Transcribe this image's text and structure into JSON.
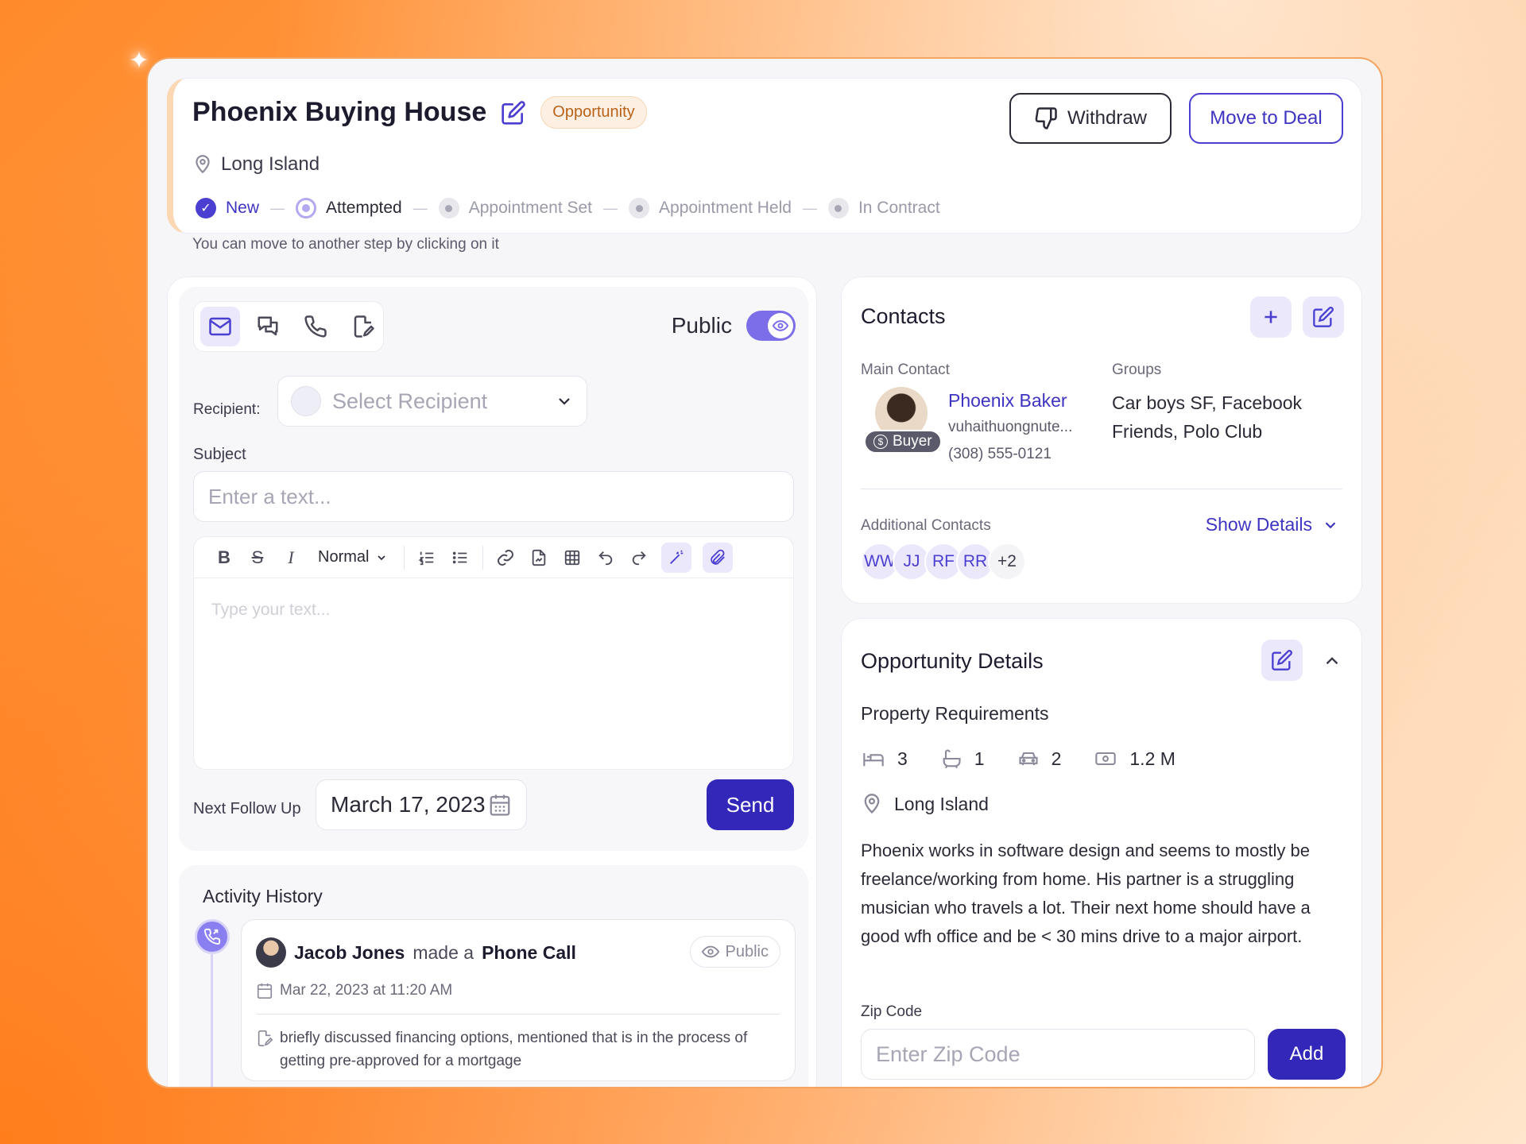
{
  "header": {
    "title": "Phoenix Buying House",
    "badge": "Opportunity",
    "location": "Long Island",
    "withdraw_label": "Withdraw",
    "move_label": "Move to Deal",
    "steps": [
      "New",
      "Attempted",
      "Appointment Set",
      "Appointment Held",
      "In Contract"
    ],
    "step_states": [
      "done",
      "current",
      "pending",
      "pending",
      "pending"
    ],
    "hint": "You can move to another step by clicking on it"
  },
  "composer": {
    "channels": [
      "mail-icon",
      "chat-icon",
      "phone-icon",
      "note-icon"
    ],
    "public_label": "Public",
    "public_on": true,
    "recipient_label": "Recipient:",
    "recipient_placeholder": "Select Recipient",
    "subject_label": "Subject",
    "subject_placeholder": "Enter a text...",
    "format_value": "Normal",
    "editor_placeholder": "Type your text...",
    "follow_label": "Next Follow Up",
    "follow_date": "March 17, 2023",
    "send_label": "Send"
  },
  "activity": {
    "title": "Activity History",
    "item": {
      "name": "Jacob Jones",
      "verb": "made a",
      "type": "Phone Call",
      "visibility": "Public",
      "date": "Mar 22, 2023 at 11:20 AM",
      "note": "briefly discussed financing options, mentioned that is in the process of getting pre-approved for a mortgage"
    }
  },
  "contacts": {
    "title": "Contacts",
    "main_label": "Main Contact",
    "groups_label": "Groups",
    "name": "Phoenix Baker",
    "role": "Buyer",
    "email": "vuhaithuongnute...",
    "phone": "(308) 555-0121",
    "groups": "Car boys SF, Facebook Friends, Polo Club",
    "additional_label": "Additional Contacts",
    "show_details": "Show Details",
    "chips": [
      "WW",
      "JJ",
      "RF",
      "RR"
    ],
    "more": "+2"
  },
  "opportunity": {
    "title": "Opportunity Details",
    "section": "Property Requirements",
    "beds": "3",
    "baths": "1",
    "garage": "2",
    "budget": "1.2 M",
    "location": "Long Island",
    "description": "Phoenix works in software design and seems to mostly be freelance/working from home. His partner is a struggling musician who travels a lot. Their next home should have a good wfh office and be < 30 mins drive to a major airport.",
    "zip_label": "Zip Code",
    "zip_placeholder": "Enter Zip Code",
    "add_label": "Add"
  },
  "colors": {
    "accent": "#4b3fd1",
    "primary_button": "#3227b8",
    "badge_bg": "#fdf0e2",
    "badge_text": "#b8621a"
  }
}
